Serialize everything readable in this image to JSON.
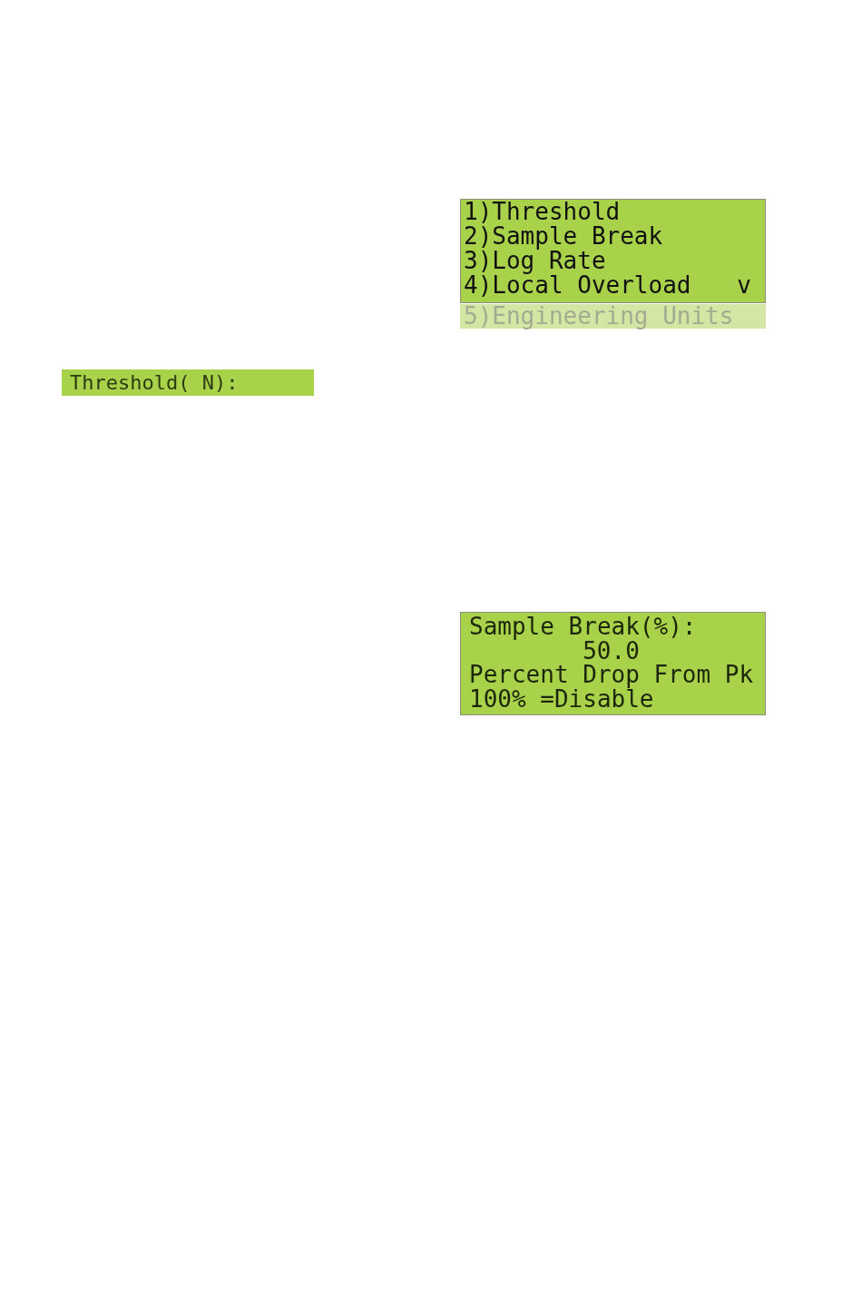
{
  "menu_screen": {
    "items": [
      {
        "label": "1)Threshold",
        "kind": "onscreen"
      },
      {
        "label": "2)Sample Break",
        "kind": "onscreen"
      },
      {
        "label": "3)Log Rate",
        "kind": "onscreen"
      },
      {
        "label": "4)Local Overload",
        "kind": "onscreen",
        "suffix": "v"
      },
      {
        "label": "5)Engineering Units",
        "kind": "offscreen"
      }
    ]
  },
  "threshold_screen": {
    "text": "Threshold( N):"
  },
  "sample_break_screen": {
    "lines": [
      {
        "text": "Sample Break(%):",
        "kind": "label"
      },
      {
        "text": "50.0",
        "kind": "value"
      },
      {
        "text": "Percent Drop From Pk",
        "kind": "label"
      },
      {
        "text": "100% =Disable",
        "kind": "label"
      }
    ]
  }
}
